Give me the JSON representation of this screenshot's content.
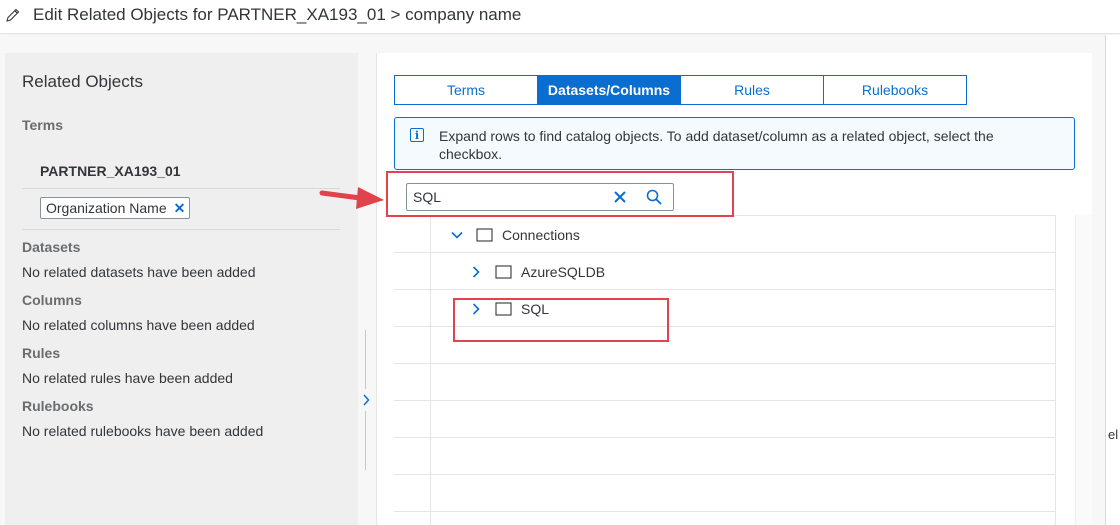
{
  "header": {
    "icon": "pencil-icon",
    "title": "Edit Related Objects for PARTNER_XA193_01 > company name"
  },
  "related": {
    "heading": "Related Objects",
    "terms_heading": "Terms",
    "term_name": "PARTNER_XA193_01",
    "token_label": "Organization Name",
    "token_remove": "✕",
    "datasets_heading": "Datasets",
    "datasets_text": "No related datasets have been added",
    "columns_heading": "Columns",
    "columns_text": "No related columns have been added",
    "rules_heading": "Rules",
    "rules_text": "No related rules have been added",
    "rulebooks_heading": "Rulebooks",
    "rulebooks_text": "No related rulebooks have been added"
  },
  "tabs": [
    {
      "label": "Terms",
      "active": false
    },
    {
      "label": "Datasets/Columns",
      "active": true
    },
    {
      "label": "Rules",
      "active": false
    },
    {
      "label": "Rulebooks",
      "active": false
    }
  ],
  "info": {
    "icon": "info-icon",
    "text": "Expand rows to find catalog objects. To add dataset/column as a related object, select the checkbox."
  },
  "search": {
    "value": "SQL",
    "clear_icon": "clear-icon",
    "search_icon": "search-icon"
  },
  "tree": {
    "nodes": [
      {
        "label": "Connections",
        "expanded": true,
        "level": 0
      },
      {
        "label": "AzureSQLDB",
        "expanded": false,
        "level": 1
      },
      {
        "label": "SQL",
        "expanded": false,
        "level": 1
      }
    ]
  },
  "edge": {
    "partial_text": "el"
  },
  "colors": {
    "accent": "#0a6ed1",
    "highlight": "#e0434b",
    "panel": "#efefef"
  }
}
